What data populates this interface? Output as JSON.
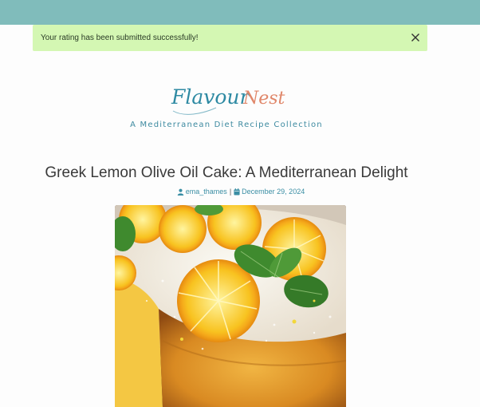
{
  "alert": {
    "message": "Your rating has been submitted successfully!"
  },
  "brand": {
    "logo_text_primary": "Flavour",
    "logo_text_secondary": "Nest",
    "tagline": "A Mediterranean Diet Recipe Collection"
  },
  "post": {
    "title": "Greek Lemon Olive Oil Cake: A Mediterranean Delight",
    "author": "ema_thames",
    "separator": "|",
    "date": "December 29, 2024"
  },
  "colors": {
    "topbar": "#80bcbb",
    "alert_bg": "#d4f7b3",
    "accent": "#3a8ea4",
    "logo_teal": "#2e8aa3",
    "logo_coral": "#e0876a"
  },
  "icons": {
    "close": "close-icon",
    "author": "user-icon",
    "date": "calendar-icon"
  }
}
